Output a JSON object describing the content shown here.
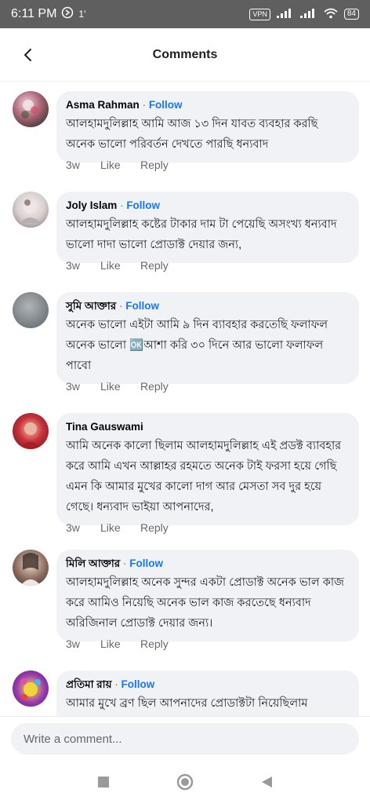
{
  "status": {
    "time": "6:11 PM",
    "extra": "1'",
    "vpn": "VPN",
    "battery": "84"
  },
  "header": {
    "title": "Comments"
  },
  "comments": [
    {
      "author": "Asma Rahman",
      "follow": "Follow",
      "text": "আলহামদুলিল্লাহ আমি আজ ১৩ দিন যাবত ব্যবহার করছি অনেক ভালো পরিবর্তন দেখতে পারছি ধন্যবাদ",
      "time": "3w",
      "like": "Like",
      "reply": "Reply"
    },
    {
      "author": "Joly Islam",
      "follow": "Follow",
      "text": "আলহামদুলিল্লাহ কষ্টের টাকার দাম টা পেয়েছি অসংখ্য ধন্যবাদ ভালো দাদা ভালো প্রোডাক্ট দেয়ার জন্য,",
      "time": "3w",
      "like": "Like",
      "reply": "Reply"
    },
    {
      "author": "সুমি আক্তার",
      "follow": "Follow",
      "text": "অনেক ভালো এইটা আমি ৯ দিন ব্যাবহার করতেছি ফলাফল অনেক ভালো 🆗আশা করি ৩০ দিনে আর ভালো ফলাফল পাবো",
      "time": "3w",
      "like": "Like",
      "reply": "Reply"
    },
    {
      "author": "Tina Gauswami",
      "follow": "Follow",
      "text": "আমি অনেক কালো ছিলাম  আলহামদুলিল্লাহ এই প্রডক্ট ব্যাবহার করে আমি এখন আল্লাহর রহমতে অনেক টাই ফরসা হয়ে গেছি এমন কি আমার মুখের কালো দাগ আর মেসতা সব দুর হয়ে গেছে। ধন্যবাদ ভাইয়া আপনাদের,",
      "time": "3w",
      "like": "Like",
      "reply": "Reply"
    },
    {
      "author": "মিলি আক্তার",
      "follow": "Follow",
      "text": "আলহামদুলিল্লাহ অনেক সুন্দর একটা প্রোডাক্ট অনেক ভাল কাজ করে আমিও নিয়েছি অনেক ভাল কাজ করতেছে ধন্যবাদ অরিজিনাল প্রোডাক্ট দেয়ার জন্য।",
      "time": "3w",
      "like": "Like",
      "reply": "Reply"
    },
    {
      "author": "প্রতিমা রায়",
      "follow": "Follow",
      "text": "আমার মুখে ব্রণ ছিল আপনাদের প্রোডাক্টটা নিয়েছিলাম",
      "time": "",
      "like": "",
      "reply": ""
    }
  ],
  "composer": {
    "placeholder": "Write a comment..."
  },
  "colors": {
    "accent": "#1877f2",
    "bubble": "#f0f2f5",
    "status_bar": "#5f5f5f"
  }
}
